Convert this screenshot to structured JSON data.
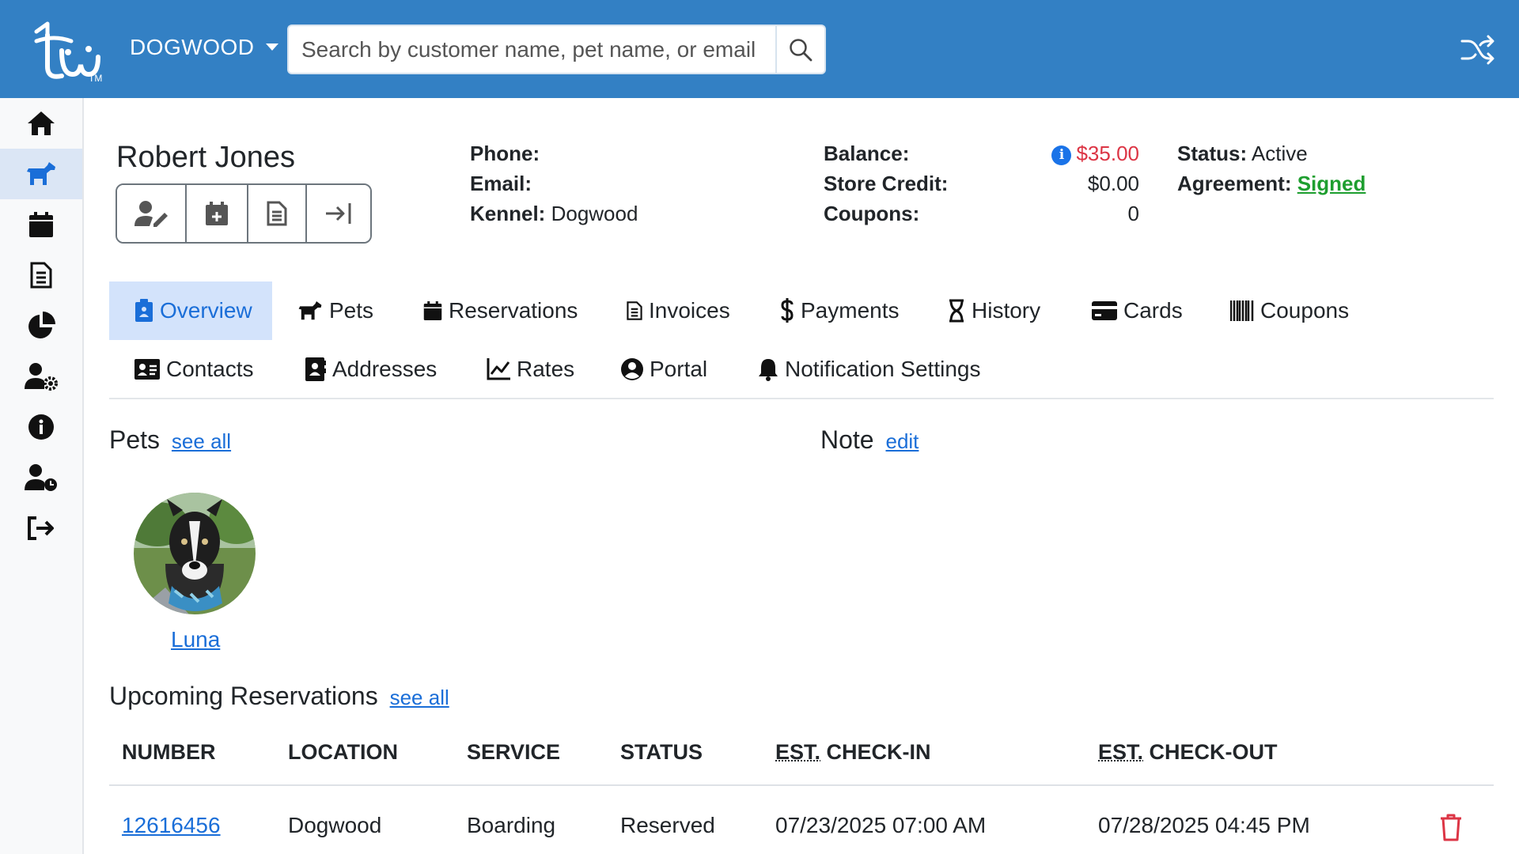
{
  "brand": {
    "tm": "TM",
    "accent": "#3380c4"
  },
  "header": {
    "kennel": "DOGWOOD",
    "search_placeholder": "Search by customer name, pet name, or email"
  },
  "sidebar": {
    "items": [
      {
        "icon": "home-icon"
      },
      {
        "icon": "dog-icon",
        "active": true
      },
      {
        "icon": "calendar-icon"
      },
      {
        "icon": "invoice-icon"
      },
      {
        "icon": "pie-chart-icon"
      },
      {
        "icon": "user-gear-icon"
      },
      {
        "icon": "info-icon"
      },
      {
        "icon": "user-clock-icon"
      },
      {
        "icon": "logout-icon"
      }
    ]
  },
  "customer": {
    "name": "Robert Jones",
    "phone_label": "Phone:",
    "phone": "",
    "email_label": "Email:",
    "email": "",
    "kennel_label": "Kennel:",
    "kennel": "Dogwood",
    "balance_label": "Balance:",
    "balance": "$35.00",
    "store_credit_label": "Store Credit:",
    "store_credit": "$0.00",
    "coupons_label": "Coupons:",
    "coupons": "0",
    "status_label": "Status:",
    "status": "Active",
    "agreement_label": "Agreement:",
    "agreement": "Signed"
  },
  "tabs": {
    "row1": [
      "Overview",
      "Pets",
      "Reservations",
      "Invoices",
      "Payments",
      "History",
      "Cards",
      "Coupons"
    ],
    "row2": [
      "Contacts",
      "Addresses",
      "Rates",
      "Portal",
      "Notification Settings"
    ],
    "active": "Overview"
  },
  "pets_section": {
    "title": "Pets",
    "see_all": "see all",
    "pets": [
      {
        "name": "Luna"
      }
    ]
  },
  "note_section": {
    "title": "Note",
    "edit": "edit"
  },
  "reservations": {
    "title": "Upcoming Reservations",
    "see_all": "see all",
    "columns": [
      "NUMBER",
      "LOCATION",
      "SERVICE",
      "STATUS",
      "EST.",
      "CHECK-IN",
      "EST.",
      "CHECK-OUT"
    ],
    "rows": [
      {
        "number": "12616456",
        "location": "Dogwood",
        "service": "Boarding",
        "status": "Reserved",
        "checkin": "07/23/2025 07:00 AM",
        "checkout": "07/28/2025 04:45 PM"
      }
    ]
  }
}
